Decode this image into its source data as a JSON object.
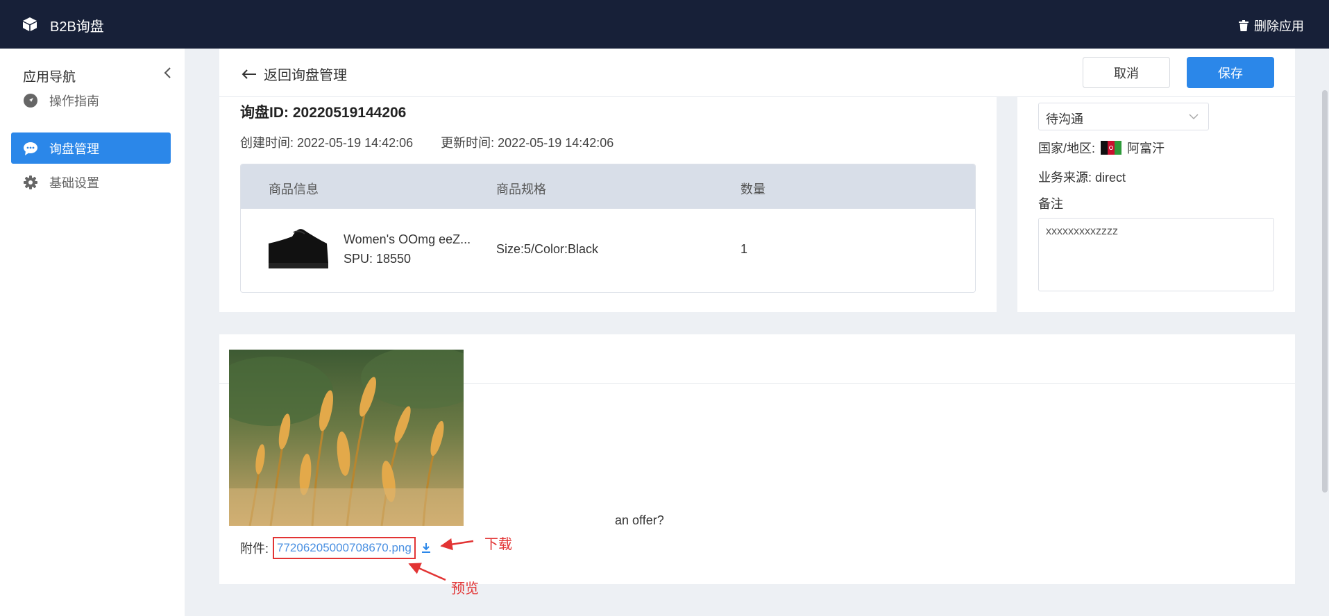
{
  "topbar": {
    "title": "B2B询盘",
    "delete_label": "删除应用"
  },
  "sidebar": {
    "title": "应用导航",
    "items": [
      {
        "label": "操作指南",
        "icon": "navigation-icon",
        "active": false
      },
      {
        "label": "询盘管理",
        "icon": "chat-icon",
        "active": true
      },
      {
        "label": "基础设置",
        "icon": "gear-icon",
        "active": false
      }
    ]
  },
  "header": {
    "back_label": "返回询盘管理",
    "cancel_label": "取消",
    "save_label": "保存"
  },
  "inquiry": {
    "id_label": "询盘ID:",
    "id_value": "20220519144206",
    "created_label": "创建时间: 2022-05-19 14:42:06",
    "updated_label": "更新时间: 2022-05-19 14:42:06"
  },
  "table": {
    "headers": [
      "商品信息",
      "商品规格",
      "数量"
    ],
    "rows": [
      {
        "name": "Women's OOmg eeZ...",
        "spu": "SPU: 18550",
        "spec": "Size:5/Color:Black",
        "qty": "1"
      }
    ]
  },
  "side": {
    "status": "待沟通",
    "country_label": "国家/地区:",
    "country_value": "阿富汗",
    "source": "业务来源:  direct",
    "remark_label": "备注",
    "remark_value": "xxxxxxxxxzzzz"
  },
  "bottom": {
    "message": "an offer?",
    "attach_label": "附件:",
    "file_name": "77206205000708670.png"
  },
  "annotations": {
    "download": "下载",
    "preview": "预览"
  },
  "colors": {
    "topbar": "#172038",
    "accent": "#2b87e9",
    "annotation": "#e23434"
  }
}
